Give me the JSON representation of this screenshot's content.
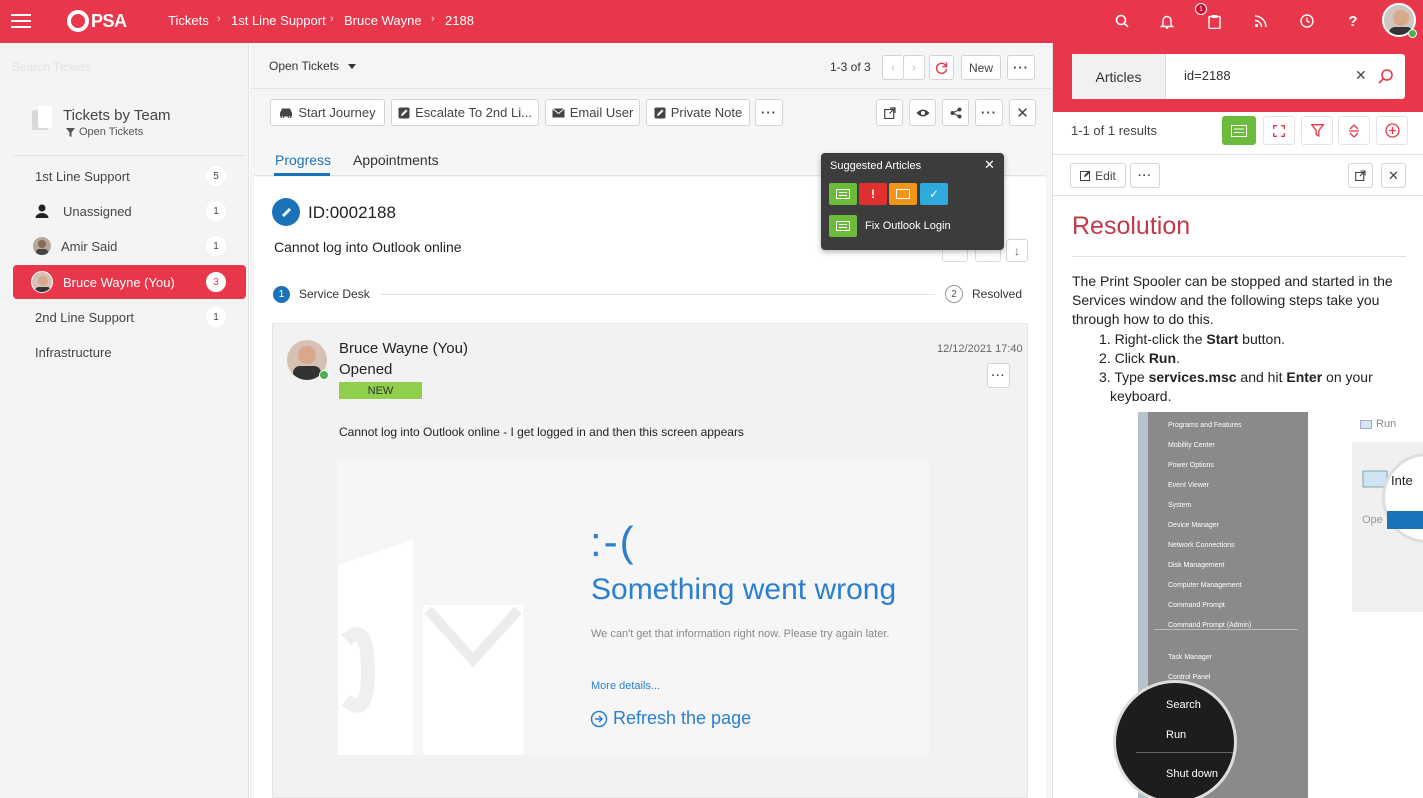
{
  "app": {
    "logo": "PSA"
  },
  "breadcrumb": [
    "Tickets",
    "1st Line Support",
    "Bruce Wayne",
    "2188"
  ],
  "topbar": {
    "notification_count": "1"
  },
  "sidebar": {
    "search_placeholder": "Search Tickets",
    "title": "Tickets by Team",
    "subtitle": "Open Tickets",
    "items": [
      {
        "label": "1st Line Support",
        "count": "5"
      },
      {
        "label": "Unassigned",
        "count": "1"
      },
      {
        "label": "Amir Said",
        "count": "1"
      },
      {
        "label": "Bruce Wayne (You)",
        "count": "3"
      },
      {
        "label": "2nd Line Support",
        "count": "1"
      },
      {
        "label": "Infrastructure",
        "count": ""
      }
    ]
  },
  "list": {
    "filter_label": "Open Tickets",
    "pager": "1-3 of 3",
    "new_label": "New"
  },
  "actions": {
    "start_journey": "Start Journey",
    "escalate": "Escalate To 2nd Li...",
    "email": "Email User",
    "private_note": "Private Note"
  },
  "tabs": [
    "Progress",
    "Appointments"
  ],
  "ticket": {
    "id": "ID:0002188",
    "summary": "Cannot log into Outlook online",
    "stage_from_num": "1",
    "stage_from": "Service Desk",
    "stage_to_num": "2",
    "stage_to": "Resolved"
  },
  "entry": {
    "author": "Bruce Wayne (You)",
    "action": "Opened",
    "badge": "NEW",
    "date": "12/12/2021 17:40",
    "body": "Cannot log into Outlook online - I get logged in and then this screen appears"
  },
  "error_screen": {
    "face": ":-(",
    "title": "Something went wrong",
    "message": "We can't get that information right now. Please try again later.",
    "more": "More details...",
    "refresh": "Refresh the page"
  },
  "popup": {
    "title": "Suggested Articles",
    "article": "Fix Outlook Login"
  },
  "articles": {
    "tab_label": "Articles",
    "search_value": "id=2188",
    "results": "1-1 of 1 results",
    "edit_label": "Edit",
    "heading": "Resolution",
    "intro": "The Print Spooler can be stopped and started in the Services window and the following steps take you through how to do this.",
    "steps": [
      {
        "pre": "Right-click the ",
        "bold": "Start",
        "post": " button."
      },
      {
        "pre": "Click ",
        "bold": "Run",
        "post": "."
      },
      {
        "pre": "Type ",
        "bold": "services.msc",
        "mid": " and hit ",
        "bold2": "Enter",
        "post": " on your keyboard."
      }
    ],
    "menu_items": [
      "Programs and Features",
      "Mobility Center",
      "Power Options",
      "Event Viewer",
      "System",
      "Device Manager",
      "Network Connections",
      "Disk Management",
      "Computer Management",
      "Command Prompt",
      "Command Prompt (Admin)",
      "Task Manager",
      "Control Panel"
    ],
    "zoom_items": [
      "Search",
      "Run",
      "Shut down"
    ],
    "run_label": "Run",
    "run_open": "Ope",
    "run_inte": "Inte"
  },
  "colors": {
    "brand": "#e8374a",
    "accent_blue": "#1a73b8",
    "green": "#6cbb3c"
  }
}
